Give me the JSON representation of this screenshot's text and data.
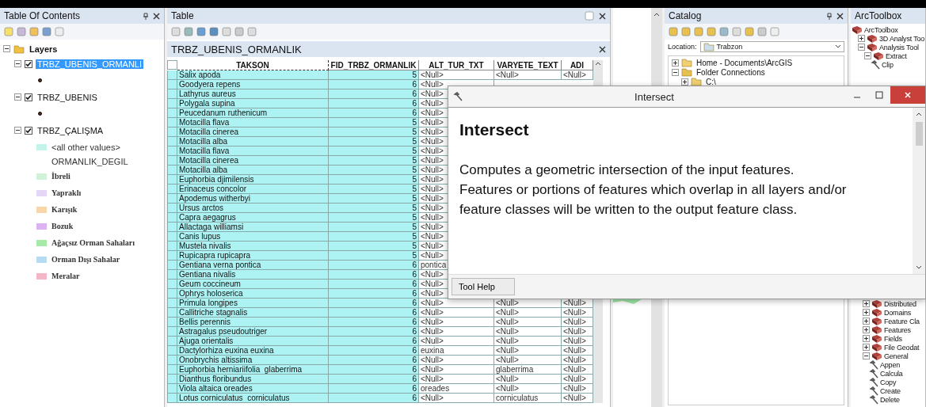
{
  "toc": {
    "title": "Table Of Contents",
    "tree": [
      {
        "label": "Layers",
        "expanded": true,
        "children": [
          {
            "label": "TRBZ_UBENIS_ORMANLI",
            "checked": true,
            "selected": true,
            "expanded": true,
            "legend": [
              {
                "kind": "point"
              }
            ]
          },
          {
            "label": "TRBZ_UBENIS",
            "checked": true,
            "selected": false,
            "expanded": true,
            "legend": [
              {
                "kind": "point"
              }
            ]
          },
          {
            "label": "TRBZ_ÇALIŞMA",
            "checked": true,
            "selected": false,
            "expanded": true,
            "legend": [
              {
                "kind": "swatch",
                "label": "<all other values>",
                "color": "#c6f2ec"
              },
              {
                "kind": "heading",
                "label": "ORMANLIK_DEGIL"
              },
              {
                "kind": "swatch",
                "label": "İbreli",
                "color": "#d2f2d8"
              },
              {
                "kind": "swatch",
                "label": "Yapraklı",
                "color": "#e4d6f6"
              },
              {
                "kind": "swatch",
                "label": "Karışık",
                "color": "#f8d6ac"
              },
              {
                "kind": "swatch",
                "label": "Bozuk",
                "color": "#dcb2f2"
              },
              {
                "kind": "swatch",
                "label": "Ağaçsız Orman Sahaları",
                "color": "#a6eaa8"
              },
              {
                "kind": "swatch",
                "label": "Orman Dışı Sahalar",
                "color": "#b6dcf4"
              },
              {
                "kind": "swatch",
                "label": "Meralar",
                "color": "#f4b6c6"
              }
            ]
          }
        ]
      }
    ]
  },
  "table": {
    "title": "Table",
    "tab": "TRBZ_UBENIS_ORMANLIK",
    "columns": [
      "TAKSON",
      "FID_TRBZ_ORMANLIK",
      "ALT_TUR_TXT",
      "VARYETE_TEXT",
      "ADI"
    ],
    "rows": [
      {
        "selected": true,
        "cells": [
          "Salix apoda",
          "5",
          "<Null>",
          "<Null>",
          "<Null>"
        ]
      },
      {
        "selected": true,
        "cells": [
          "Goodyera repens",
          "6",
          "<Null>"
        ]
      },
      {
        "selected": true,
        "cells": [
          "Lathyrus aureus",
          "6",
          "<Null>"
        ]
      },
      {
        "selected": true,
        "cells": [
          "Polygala supina",
          "6",
          "<Null>"
        ]
      },
      {
        "selected": true,
        "cells": [
          "Peucedanum ruthenicum",
          "6",
          "<Null>"
        ]
      },
      {
        "selected": true,
        "cells": [
          "Motacilla flava",
          "5",
          "<Null>"
        ]
      },
      {
        "selected": true,
        "cells": [
          "Motacilla cinerea",
          "5",
          "<Null>"
        ]
      },
      {
        "selected": true,
        "cells": [
          "Motacilla alba",
          "5",
          "<Null>"
        ]
      },
      {
        "selected": true,
        "cells": [
          "Motacilla flava",
          "5",
          "<Null>"
        ]
      },
      {
        "selected": true,
        "cells": [
          "Motacilla cinerea",
          "5",
          "<Null>"
        ]
      },
      {
        "selected": true,
        "cells": [
          "Motacilla alba",
          "5",
          "<Null>"
        ]
      },
      {
        "selected": true,
        "cells": [
          "Euphorbia djimilensis",
          "5",
          "<Null>"
        ]
      },
      {
        "selected": true,
        "cells": [
          "Erinaceus concolor",
          "5",
          "<Null>"
        ]
      },
      {
        "selected": true,
        "cells": [
          "Apodemus witherbyi",
          "5",
          "<Null>"
        ]
      },
      {
        "selected": true,
        "cells": [
          "Ursus arctos",
          "5",
          "<Null>"
        ]
      },
      {
        "selected": true,
        "cells": [
          "Capra aegagrus",
          "5",
          "<Null>"
        ]
      },
      {
        "selected": true,
        "cells": [
          "Allactaga williamsi",
          "5",
          "<Null>"
        ]
      },
      {
        "selected": true,
        "cells": [
          "Canis lupus",
          "5",
          "<Null>"
        ]
      },
      {
        "selected": true,
        "cells": [
          "Mustela nivalis",
          "5",
          "<Null>"
        ]
      },
      {
        "selected": true,
        "cells": [
          "Rupicapra rupicapra",
          "5",
          "<Null>"
        ]
      },
      {
        "selected": true,
        "cells": [
          "Gentiana verna pontica",
          "6",
          "pontica"
        ]
      },
      {
        "selected": true,
        "cells": [
          "Gentiana nivalis",
          "6",
          "<Null>"
        ]
      },
      {
        "selected": true,
        "cells": [
          "Geum coccineum",
          "6",
          "<Null>"
        ]
      },
      {
        "selected": true,
        "cells": [
          "Ophrys holoserica",
          "6",
          "<Null>"
        ]
      },
      {
        "selected": true,
        "cells": [
          "Primula longipes",
          "6",
          "<Null>",
          "<Null>",
          "<Null>"
        ]
      },
      {
        "selected": true,
        "cells": [
          "Callitriche stagnalis",
          "6",
          "<Null>",
          "<Null>",
          "<Null>"
        ]
      },
      {
        "selected": true,
        "cells": [
          "Bellis perennis",
          "6",
          "<Null>",
          "<Null>",
          "<Null>"
        ]
      },
      {
        "selected": true,
        "cells": [
          "Astragalus pseudoutriger",
          "6",
          "<Null>",
          "<Null>",
          "<Null>"
        ]
      },
      {
        "selected": true,
        "cells": [
          "Ajuga orientalis",
          "6",
          "<Null>",
          "<Null>",
          "<Null>"
        ]
      },
      {
        "selected": true,
        "cells": [
          "Dactylorhiza euxina euxina",
          "6",
          "euxina",
          "<Null>",
          "<Null>"
        ]
      },
      {
        "selected": true,
        "cells": [
          "Onobrychis altissima",
          "6",
          "<Null>",
          "<Null>",
          "<Null>"
        ]
      },
      {
        "selected": true,
        "cells": [
          "Euphorbia herniariifolia  glaberrima",
          "6",
          "<Null>",
          "glaberrima",
          "<Null>"
        ]
      },
      {
        "selected": true,
        "cells": [
          "Dianthus floribundus",
          "6",
          "<Null>",
          "<Null>",
          "<Null>"
        ]
      },
      {
        "selected": true,
        "cells": [
          "Viola altaica oreades",
          "6",
          "oreades",
          "<Null>",
          "<Null>"
        ]
      },
      {
        "selected": true,
        "cells": [
          "Lotus corniculatus  corniculatus",
          "6",
          "<Null>",
          "corniculatus",
          "<Null>"
        ]
      }
    ]
  },
  "catalog": {
    "title": "Catalog",
    "location_label": "Location:",
    "location": "Trabzon",
    "tree": [
      {
        "label": "Home - Documents\\ArcGIS",
        "expanded": false
      },
      {
        "label": "Folder Connections",
        "expanded": true,
        "children": [
          {
            "label": "C:\\",
            "expanded": false
          }
        ]
      }
    ]
  },
  "toolbox": {
    "title": "ArcToolbox",
    "top": [
      {
        "kind": "toolbox",
        "label": "ArcToolbox",
        "children": [
          {
            "kind": "toolset",
            "label": "3D Analyst Too",
            "expanded": false
          },
          {
            "kind": "toolset",
            "label": "Analysis Tool",
            "expanded": true,
            "children": [
              {
                "kind": "toolset",
                "label": "Extract",
                "expanded": true,
                "children": [
                  {
                    "kind": "tool",
                    "label": "Clip"
                  }
                ]
              }
            ]
          }
        ]
      }
    ],
    "bottom": [
      {
        "kind": "toolset",
        "label": "Distributed",
        "expanded": false
      },
      {
        "kind": "toolset",
        "label": "Domains",
        "expanded": false
      },
      {
        "kind": "toolset",
        "label": "Feature Cla",
        "expanded": false
      },
      {
        "kind": "toolset",
        "label": "Features",
        "expanded": false
      },
      {
        "kind": "toolset",
        "label": "Fields",
        "expanded": false
      },
      {
        "kind": "toolset",
        "label": "File Geodat",
        "expanded": false
      },
      {
        "kind": "toolset",
        "label": "General",
        "expanded": true,
        "children": [
          {
            "kind": "tool",
            "label": "Appen"
          },
          {
            "kind": "tool",
            "label": "Calcula"
          },
          {
            "kind": "tool",
            "label": "Copy"
          },
          {
            "kind": "tool",
            "label": "Create"
          },
          {
            "kind": "tool",
            "label": "Delete"
          }
        ]
      }
    ]
  },
  "dialog": {
    "title": "Intersect",
    "heading": "Intersect",
    "description": [
      "Computes a geometric intersection of the input features.",
      "Features or portions of features which overlap in all layers and/or feature classes will be written to the output feature class."
    ],
    "buttons": [
      "Tool Help"
    ]
  }
}
